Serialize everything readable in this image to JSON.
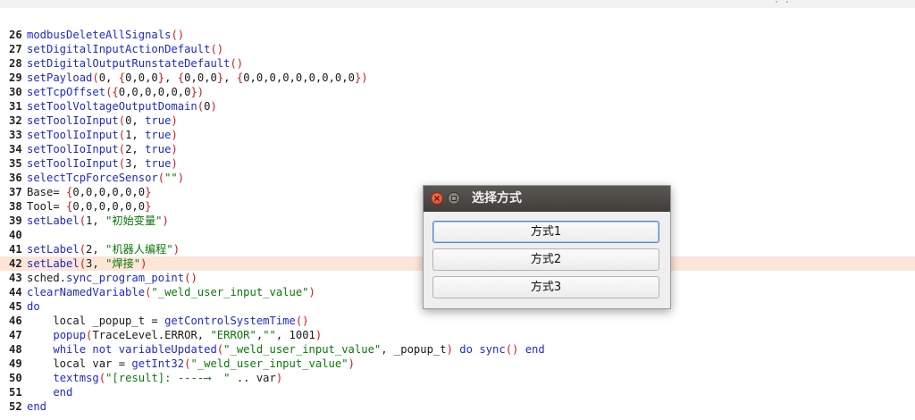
{
  "editor": {
    "lines": [
      {
        "n": "26",
        "hl": false,
        "t": [
          [
            "fn",
            "modbusDeleteAllSignals"
          ],
          [
            "br",
            "()"
          ]
        ]
      },
      {
        "n": "27",
        "hl": false,
        "t": [
          [
            "fn",
            "setDigitalInputActionDefault"
          ],
          [
            "br",
            "()"
          ]
        ]
      },
      {
        "n": "28",
        "hl": false,
        "t": [
          [
            "fn",
            "setDigitalOutputRunstateDefault"
          ],
          [
            "br",
            "()"
          ]
        ]
      },
      {
        "n": "29",
        "hl": false,
        "t": [
          [
            "fn",
            "setPayload"
          ],
          [
            "br",
            "("
          ],
          [
            "plain",
            "0, "
          ],
          [
            "br",
            "{"
          ],
          [
            "plain",
            "0,0,0"
          ],
          [
            "br",
            "}"
          ],
          [
            "plain",
            ", "
          ],
          [
            "br",
            "{"
          ],
          [
            "plain",
            "0,0,0"
          ],
          [
            "br",
            "}"
          ],
          [
            "plain",
            ", "
          ],
          [
            "br",
            "{"
          ],
          [
            "plain",
            "0,0,0,0,0,0,0,0,0"
          ],
          [
            "br",
            "})"
          ]
        ]
      },
      {
        "n": "30",
        "hl": false,
        "t": [
          [
            "fn",
            "setTcpOffset"
          ],
          [
            "br",
            "({"
          ],
          [
            "plain",
            "0,0,0,0,0,0"
          ],
          [
            "br",
            "})"
          ]
        ]
      },
      {
        "n": "31",
        "hl": false,
        "t": [
          [
            "fn",
            "setToolVoltageOutputDomain"
          ],
          [
            "br",
            "("
          ],
          [
            "plain",
            "0"
          ],
          [
            "br",
            ")"
          ]
        ]
      },
      {
        "n": "32",
        "hl": false,
        "t": [
          [
            "fn",
            "setToolIoInput"
          ],
          [
            "br",
            "("
          ],
          [
            "plain",
            "0, "
          ],
          [
            "fn",
            "true"
          ],
          [
            "br",
            ")"
          ]
        ]
      },
      {
        "n": "33",
        "hl": false,
        "t": [
          [
            "fn",
            "setToolIoInput"
          ],
          [
            "br",
            "("
          ],
          [
            "plain",
            "1, "
          ],
          [
            "fn",
            "true"
          ],
          [
            "br",
            ")"
          ]
        ]
      },
      {
        "n": "34",
        "hl": false,
        "t": [
          [
            "fn",
            "setToolIoInput"
          ],
          [
            "br",
            "("
          ],
          [
            "plain",
            "2, "
          ],
          [
            "fn",
            "true"
          ],
          [
            "br",
            ")"
          ]
        ]
      },
      {
        "n": "35",
        "hl": false,
        "t": [
          [
            "fn",
            "setToolIoInput"
          ],
          [
            "br",
            "("
          ],
          [
            "plain",
            "3, "
          ],
          [
            "fn",
            "true"
          ],
          [
            "br",
            ")"
          ]
        ]
      },
      {
        "n": "36",
        "hl": false,
        "t": [
          [
            "fn",
            "selectTcpForceSensor"
          ],
          [
            "br",
            "("
          ],
          [
            "str",
            "\"\""
          ],
          [
            "br",
            ")"
          ]
        ]
      },
      {
        "n": "37",
        "hl": false,
        "t": [
          [
            "plain",
            "Base= "
          ],
          [
            "br",
            "{"
          ],
          [
            "plain",
            "0,0,0,0,0,0"
          ],
          [
            "br",
            "}"
          ]
        ]
      },
      {
        "n": "38",
        "hl": false,
        "t": [
          [
            "plain",
            "Tool= "
          ],
          [
            "br",
            "{"
          ],
          [
            "plain",
            "0,0,0,0,0,0"
          ],
          [
            "br",
            "}"
          ]
        ]
      },
      {
        "n": "39",
        "hl": false,
        "t": [
          [
            "fn",
            "setLabel"
          ],
          [
            "br",
            "("
          ],
          [
            "plain",
            "1, "
          ],
          [
            "str",
            "\"初始变量\""
          ],
          [
            "br",
            ")"
          ]
        ]
      },
      {
        "n": "40",
        "hl": false,
        "t": []
      },
      {
        "n": "41",
        "hl": false,
        "t": [
          [
            "fn",
            "setLabel"
          ],
          [
            "br",
            "("
          ],
          [
            "plain",
            "2, "
          ],
          [
            "str",
            "\"机器人编程\""
          ],
          [
            "br",
            ")"
          ]
        ]
      },
      {
        "n": "42",
        "hl": true,
        "t": [
          [
            "fn",
            "setLabel"
          ],
          [
            "br",
            "("
          ],
          [
            "plain",
            "3, "
          ],
          [
            "str",
            "\"焊接\""
          ],
          [
            "br",
            ")"
          ]
        ]
      },
      {
        "n": "43",
        "hl": false,
        "t": [
          [
            "plain",
            "sched."
          ],
          [
            "fn",
            "sync_program_point"
          ],
          [
            "br",
            "()"
          ]
        ]
      },
      {
        "n": "44",
        "hl": false,
        "t": [
          [
            "fn",
            "clearNamedVariable"
          ],
          [
            "br",
            "("
          ],
          [
            "str",
            "\"_weld_user_input_value\""
          ],
          [
            "br",
            ")"
          ]
        ]
      },
      {
        "n": "45",
        "hl": false,
        "t": [
          [
            "kw",
            "do"
          ]
        ]
      },
      {
        "n": "46",
        "hl": false,
        "t": [
          [
            "plain",
            "    local _popup_t = "
          ],
          [
            "fn",
            "getControlSystemTime"
          ],
          [
            "br",
            "()"
          ]
        ]
      },
      {
        "n": "47",
        "hl": false,
        "t": [
          [
            "plain",
            "    "
          ],
          [
            "fn",
            "popup"
          ],
          [
            "br",
            "("
          ],
          [
            "plain",
            "TraceLevel.ERROR, "
          ],
          [
            "str",
            "\"ERROR\""
          ],
          [
            "plain",
            ","
          ],
          [
            "str",
            "\"\""
          ],
          [
            "plain",
            ", 1001"
          ],
          [
            "br",
            ")"
          ]
        ]
      },
      {
        "n": "48",
        "hl": false,
        "t": [
          [
            "plain",
            "    "
          ],
          [
            "kw",
            "while not "
          ],
          [
            "fn",
            "variableUpdated"
          ],
          [
            "br",
            "("
          ],
          [
            "str",
            "\"_weld_user_input_value\""
          ],
          [
            "plain",
            ", _popup_t"
          ],
          [
            "br",
            ")"
          ],
          [
            "kw",
            " do "
          ],
          [
            "fn",
            "sync"
          ],
          [
            "br",
            "()"
          ],
          [
            "kw",
            " end"
          ]
        ]
      },
      {
        "n": "49",
        "hl": false,
        "t": [
          [
            "plain",
            "    local var = "
          ],
          [
            "fn",
            "getInt32"
          ],
          [
            "br",
            "("
          ],
          [
            "str",
            "\"_weld_user_input_value\""
          ],
          [
            "br",
            ")"
          ]
        ]
      },
      {
        "n": "50",
        "hl": false,
        "t": [
          [
            "plain",
            "    "
          ],
          [
            "fn",
            "textmsg"
          ],
          [
            "br",
            "("
          ],
          [
            "str",
            "\"[result]: ----⟶  \""
          ],
          [
            "plain",
            " .. var"
          ],
          [
            "br",
            ")"
          ]
        ]
      },
      {
        "n": "51",
        "hl": false,
        "t": [
          [
            "kw",
            "    end"
          ]
        ]
      },
      {
        "n": "52",
        "hl": false,
        "t": [
          [
            "kw",
            "end"
          ]
        ]
      }
    ]
  },
  "dialog": {
    "title": "选择方式",
    "buttons": [
      "方式1",
      "方式2",
      "方式3"
    ]
  }
}
